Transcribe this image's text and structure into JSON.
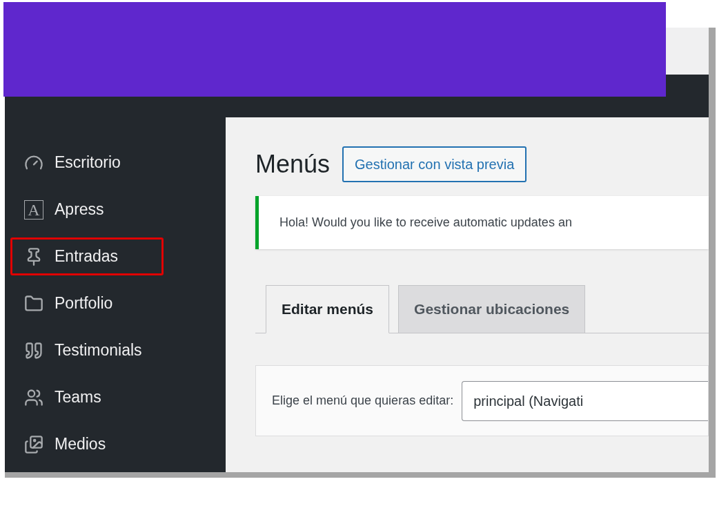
{
  "overlay": {
    "color": "#5f27cd"
  },
  "sidebar": {
    "items": [
      {
        "kind": "dashboard",
        "label": "Escritorio",
        "highlighted": false
      },
      {
        "kind": "letter",
        "icon_letter": "A",
        "label": "Apress",
        "highlighted": false
      },
      {
        "kind": "pin",
        "label": "Entradas",
        "highlighted": true
      },
      {
        "kind": "folder",
        "label": "Portfolio",
        "highlighted": false
      },
      {
        "kind": "quote",
        "label": "Testimonials",
        "highlighted": false
      },
      {
        "kind": "team",
        "label": "Teams",
        "highlighted": false
      },
      {
        "kind": "media",
        "label": "Medios",
        "highlighted": false
      }
    ]
  },
  "page": {
    "title": "Menús",
    "preview_button": "Gestionar con vista previa",
    "notice": "Hola! Would you like to receive automatic updates an",
    "tabs": [
      {
        "label": "Editar menús",
        "selected": true
      },
      {
        "label": "Gestionar ubicaciones",
        "selected": false
      }
    ],
    "menu_select": {
      "label": "Elige el menú que quieras editar:",
      "value": "principal (Navigati"
    }
  }
}
